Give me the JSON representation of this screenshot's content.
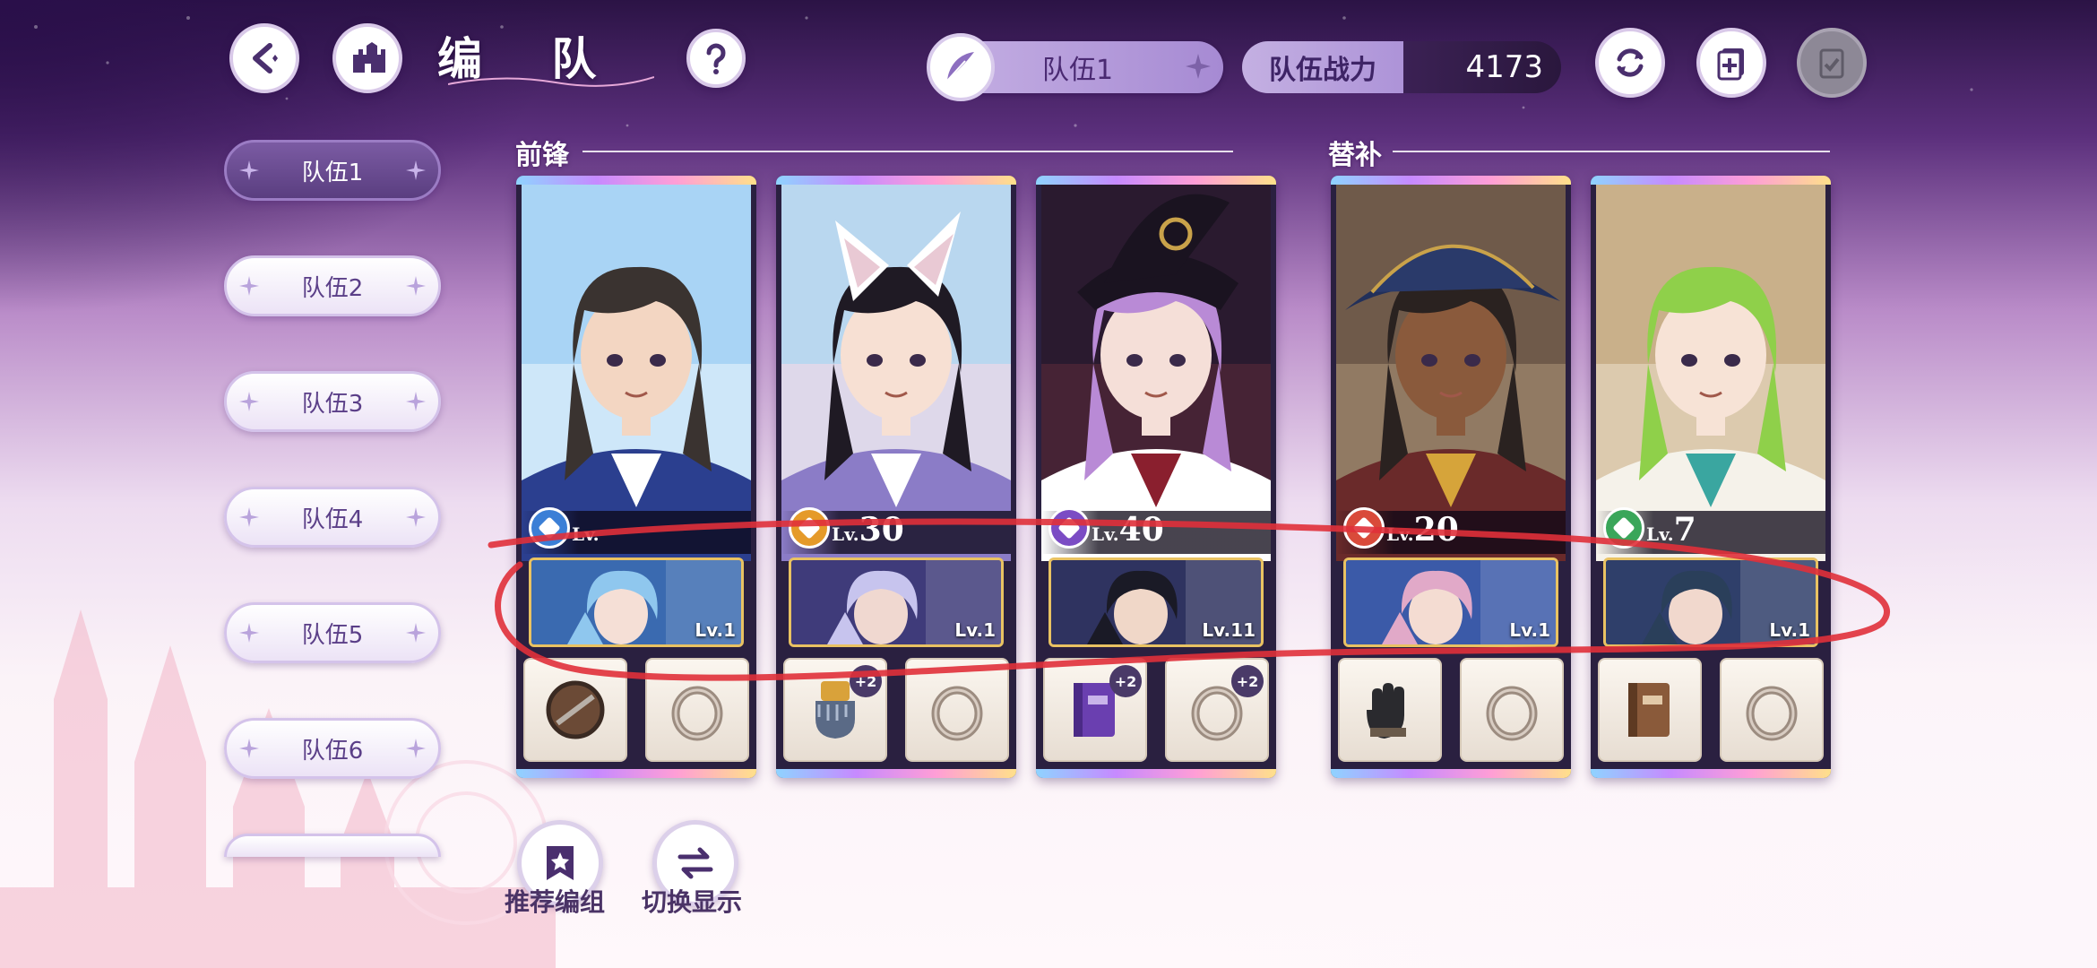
{
  "header": {
    "title": "编 队",
    "team_selector": "队伍1",
    "power_label": "队伍战力",
    "power_value": "4173"
  },
  "tabs": [
    "队伍1",
    "队伍2",
    "队伍3",
    "队伍4",
    "队伍5",
    "队伍6",
    ""
  ],
  "active_tab": 0,
  "sections": {
    "front": "前锋",
    "sub": "替补"
  },
  "cards": [
    {
      "main_lv": "",
      "support_lv": "Lv.1",
      "element_color": "#3b7fd6",
      "equip": [
        {
          "icon": "shield-icon",
          "plus": ""
        },
        {
          "icon": "ring-icon",
          "plus": ""
        }
      ]
    },
    {
      "main_lv": "30",
      "support_lv": "Lv.1",
      "element_color": "#e59a2a",
      "equip": [
        {
          "icon": "gauntlet-icon",
          "plus": "+2"
        },
        {
          "icon": "ring-icon",
          "plus": ""
        }
      ]
    },
    {
      "main_lv": "40",
      "support_lv": "Lv.11",
      "element_color": "#7b4cc4",
      "equip": [
        {
          "icon": "book-icon",
          "plus": "+2"
        },
        {
          "icon": "ring-icon",
          "plus": "+2"
        }
      ]
    },
    {
      "main_lv": "20",
      "support_lv": "Lv.1",
      "element_color": "#d94a3a",
      "equip": [
        {
          "icon": "glove-icon",
          "plus": ""
        },
        {
          "icon": "ring-icon",
          "plus": ""
        }
      ]
    },
    {
      "main_lv": "7",
      "support_lv": "Lv.1",
      "element_color": "#3aa65a",
      "equip": [
        {
          "icon": "book-icon",
          "plus": ""
        },
        {
          "icon": "ring-icon",
          "plus": ""
        }
      ]
    }
  ],
  "lv_prefix": "Lv.",
  "bottom": {
    "recommend": "推荐编组",
    "switch": "切换显示"
  },
  "colors": {
    "accent": "#7b5ba3",
    "annotation": "#e0303a"
  }
}
